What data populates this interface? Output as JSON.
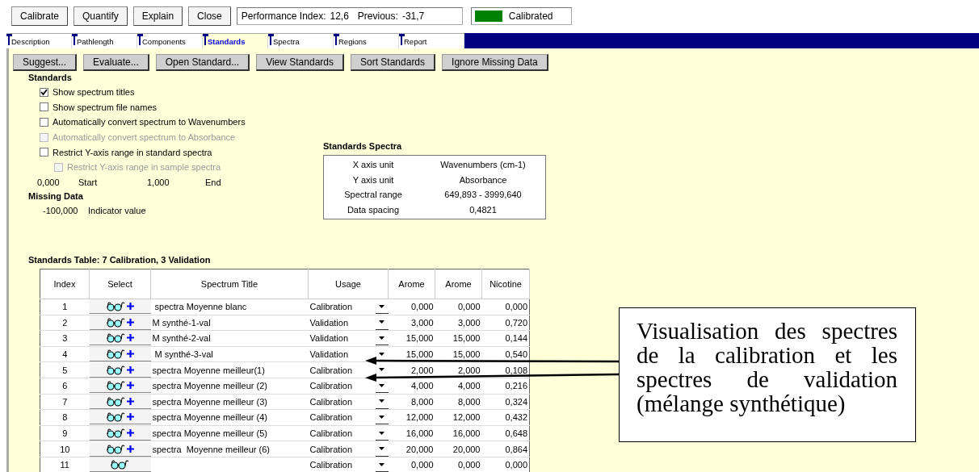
{
  "toolbar": {
    "buttons": [
      "Calibrate",
      "Quantify",
      "Explain",
      "Close"
    ],
    "performance": {
      "label": "Performance Index:",
      "value": "12,6",
      "previous_label": "Previous:",
      "previous_value": "-31,7"
    },
    "status": {
      "label": "Calibrated",
      "calibrated": true
    }
  },
  "tabs": [
    {
      "label": "Description",
      "selected": false
    },
    {
      "label": "Pathlength",
      "selected": false
    },
    {
      "label": "Components",
      "selected": false
    },
    {
      "label": "Standards",
      "selected": true
    },
    {
      "label": "Spectra",
      "selected": false
    },
    {
      "label": "Regions",
      "selected": false
    },
    {
      "label": "Report",
      "selected": false
    }
  ],
  "actions": [
    "Suggest...",
    "Evaluate...",
    "Open Standard...",
    "View Standards",
    "Sort Standards",
    "Ignore Missing Data"
  ],
  "standards": {
    "title": "Standards",
    "options": [
      {
        "label": "Show spectrum titles",
        "checked": true,
        "disabled": false
      },
      {
        "label": "Show spectrum file names",
        "checked": false,
        "disabled": false
      },
      {
        "label": "Automatically convert spectrum to Wavenumbers",
        "checked": false,
        "disabled": false
      },
      {
        "label": "Automatically convert spectrum to Absorbance",
        "checked": false,
        "disabled": true
      },
      {
        "label": "Restrict Y-axis range in standard spectra",
        "checked": false,
        "disabled": false,
        "children": [
          {
            "label": "Restrict Y-axis range in sample spectra",
            "checked": false,
            "disabled": true
          }
        ]
      }
    ],
    "range": {
      "start_value": "0,000",
      "start_label": "Start",
      "end_value": "1,000",
      "end_label": "End"
    }
  },
  "missing_data": {
    "title": "Missing Data",
    "value": "-100,000",
    "label": "Indicator value"
  },
  "standards_spectra": {
    "title": "Standards Spectra",
    "rows": [
      {
        "label": "X axis unit",
        "value": "Wavenumbers (cm-1)"
      },
      {
        "label": "Y axis unit",
        "value": "Absorbance"
      },
      {
        "label": "Spectral range",
        "value": "649,893 - 3999,640"
      },
      {
        "label": "Data spacing",
        "value": "0,4821"
      }
    ]
  },
  "table": {
    "title": "Standards Table: 7 Calibration, 3 Validation",
    "columns": [
      "Index",
      "Select",
      "Spectrum Title",
      "Usage",
      "Arome",
      "Arome",
      "Nicotine"
    ],
    "rows": [
      {
        "index": "1",
        "add": true,
        "title": " spectra Moyenne blanc",
        "usage": "Calibration",
        "values": [
          "0,000",
          "0,000",
          "0,000"
        ]
      },
      {
        "index": "2",
        "add": true,
        "title": "M synthé-1-val",
        "usage": "Validation",
        "values": [
          "3,000",
          "3,000",
          "0,720"
        ]
      },
      {
        "index": "3",
        "add": true,
        "title": "M synthé-2-val",
        "usage": "Validation",
        "values": [
          "15,000",
          "15,000",
          "0,144"
        ]
      },
      {
        "index": "4",
        "add": true,
        "title": " M synthé-3-val",
        "usage": "Validation",
        "values": [
          "15,000",
          "15,000",
          "0,540"
        ]
      },
      {
        "index": "5",
        "add": true,
        "title": "spectra Moyenne meilleur(1)",
        "usage": "Calibration",
        "values": [
          "2,000",
          "2,000",
          "0,108"
        ]
      },
      {
        "index": "6",
        "add": true,
        "title": "spectra Moyenne meilleur (2)",
        "usage": "Calibration",
        "values": [
          "4,000",
          "4,000",
          "0,216"
        ]
      },
      {
        "index": "7",
        "add": true,
        "title": "spectra Moyenne meilleur (3)",
        "usage": "Calibration",
        "values": [
          "8,000",
          "8,000",
          "0,324"
        ]
      },
      {
        "index": "8",
        "add": true,
        "title": "spectra Moyenne meilleur (4)",
        "usage": "Calibration",
        "values": [
          "12,000",
          "12,000",
          "0,432"
        ]
      },
      {
        "index": "9",
        "add": true,
        "title": "spectra Moyenne meilleur (5)",
        "usage": "Calibration",
        "values": [
          "16,000",
          "16,000",
          "0,648"
        ]
      },
      {
        "index": "10",
        "add": true,
        "title": "spectra  Moyenne meilleur (6)",
        "usage": "Calibration",
        "values": [
          "20,000",
          "20,000",
          "0,864"
        ]
      },
      {
        "index": "11",
        "add": false,
        "title": "",
        "usage": "Calibration",
        "values": [
          "0,000",
          "0,000",
          "0,000"
        ]
      }
    ]
  },
  "callout": {
    "text": "Visualisation des spectres de la calibration et les spectres de validation (mélange synthétique)"
  }
}
